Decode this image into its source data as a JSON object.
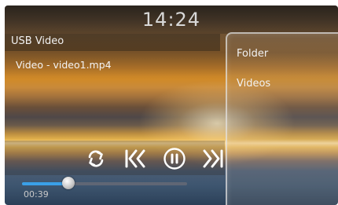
{
  "status_bar": {
    "time": "14:24"
  },
  "player": {
    "source_title": "USB Video",
    "file_name": "Video - video1.mp4",
    "elapsed_time": "00:39",
    "progress_fraction": 0.28,
    "controls": [
      "repeat-icon",
      "previous-icon",
      "pause-icon",
      "next-icon"
    ]
  },
  "side_menu": {
    "items": [
      {
        "label": "Folder"
      },
      {
        "label": "Videos"
      }
    ]
  },
  "colors": {
    "progress_accent": "#3aa0e8",
    "text": "#f2f2f2",
    "icon": "#ffffff"
  }
}
